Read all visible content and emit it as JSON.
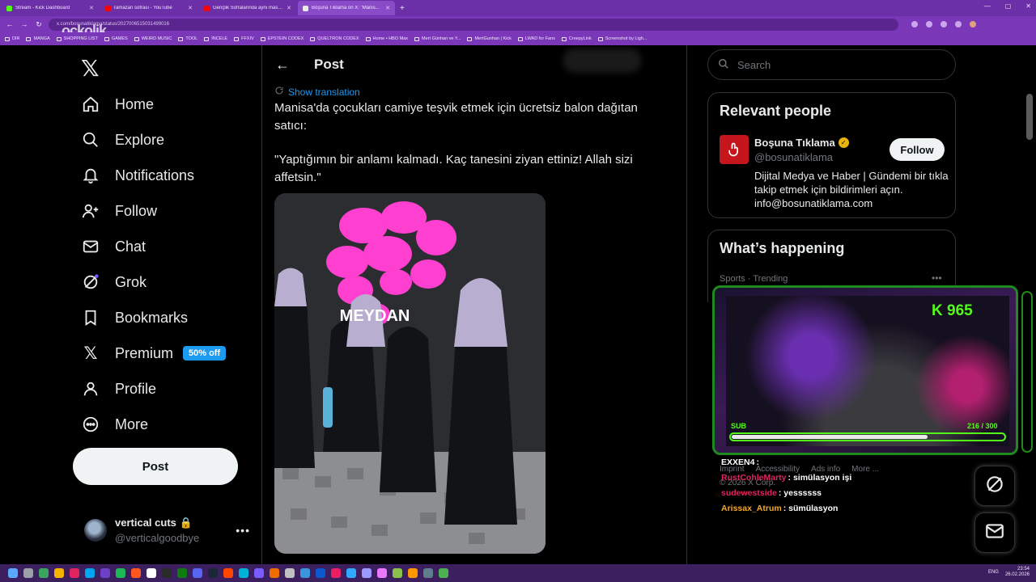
{
  "browser": {
    "tabs": [
      {
        "label": "Stream - Kick Dashboard",
        "color": "#53fc18"
      },
      {
        "label": "ramazan sofrası - YouTube",
        "color": "#ff0000"
      },
      {
        "label": "Gençlik Sofralarında aynı masa etr...",
        "color": "#ff0000"
      },
      {
        "label": "Boşuna Tıklama on X: \"Manis...",
        "color": "#e7e9ea"
      }
    ],
    "url": "x.com/bosunatiklama/status/2027006515031499016",
    "bookmarks": [
      "DIR",
      "MANGA",
      "SHOPPING LIST",
      "GAMES",
      "WEIRD MUSIC",
      "TOOL",
      "İNCELE",
      "FFXIV",
      "EPSTEIN CODEX",
      "QUELTRON CODEX",
      "Home • HBO Max",
      "Mert Günhan ve Y...",
      "MertGunhan | Kick",
      "LWAD for Fans",
      "CreepyLink",
      "Screenshot by Ligh..."
    ],
    "watermark": "ockolik"
  },
  "nav": {
    "items": [
      {
        "label": "Home",
        "icon": "home-icon"
      },
      {
        "label": "Explore",
        "icon": "search-icon"
      },
      {
        "label": "Notifications",
        "icon": "bell-icon"
      },
      {
        "label": "Follow",
        "icon": "person-plus-icon"
      },
      {
        "label": "Chat",
        "icon": "mail-icon"
      },
      {
        "label": "Grok",
        "icon": "grok-icon"
      },
      {
        "label": "Bookmarks",
        "icon": "bookmark-icon"
      },
      {
        "label": "Premium",
        "icon": "x-icon"
      },
      {
        "label": "Profile",
        "icon": "person-icon"
      },
      {
        "label": "More",
        "icon": "more-circle-icon"
      }
    ],
    "premium_badge": "50% off",
    "post_button": "Post",
    "account": {
      "name": "vertical cuts",
      "handle": "@verticalgoodbye"
    }
  },
  "main": {
    "header_title": "Post",
    "show_translation": "Show translation",
    "tweet_paragraphs": [
      "Manisa'da çocukları camiye teşvik etmek için ücretsiz balon dağıtan satıcı:",
      "\"Yaptığımın bir anlamı kalmadı. Kaç tanesini ziyan ettiniz! Allah sizi affetsin.\""
    ],
    "media_watermark": "MEYDAN"
  },
  "right": {
    "search_placeholder": "Search",
    "relevant_people": {
      "title": "Relevant people",
      "name": "Boşuna Tıklama",
      "handle": "@bosunatiklama",
      "follow": "Follow",
      "bio": "Dijital Medya ve Haber | Gündemi bir tıkla takip etmek için bildirimleri açın. info@bosunatiklama.com"
    },
    "whats_happening": {
      "title": "What’s happening",
      "trend_label": "Sports · Trending"
    },
    "footer": [
      "Imprint",
      "Accessibility",
      "Ads info",
      "More ..."
    ],
    "copyright": "© 2026 X Corp."
  },
  "stream": {
    "kick_count": "965",
    "sub_label": "SUB",
    "sub_count": "216 / 300",
    "sub_progress": 0.72,
    "chat": [
      {
        "user": "EXXEN4",
        "color": "#e7e9ea",
        "text": ""
      },
      {
        "user": "RustCohleMarty",
        "color": "#e0245e",
        "text": "simülasyon işi"
      },
      {
        "user": "sudewestside",
        "color": "#e0245e",
        "text": "yessssss"
      },
      {
        "user": "Arissax_Atrum",
        "color": "#f5a623",
        "text": "sümülasyon"
      }
    ]
  },
  "taskbar": {
    "lang": "ENG",
    "time": "23:54",
    "date": "26.02.2026"
  }
}
